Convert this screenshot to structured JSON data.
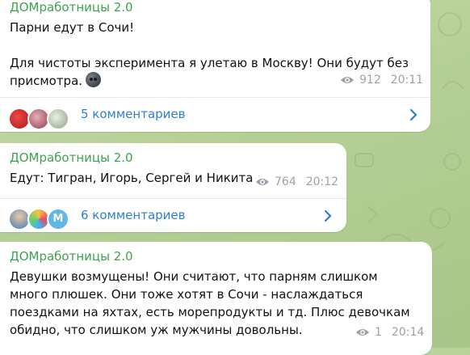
{
  "posts": [
    {
      "author": "ДОМработницы 2.0",
      "text": "Парни едут в Сочи!\n\nДля чистоты эксперимента я улетаю в Москву! Они будут без присмотра.",
      "emoji_icon": "neutral-face-dark-emoji",
      "views": "912",
      "time": "20:11",
      "comments_label": "5 комментариев"
    },
    {
      "author": "ДОМработницы 2.0",
      "text": "Едут: Тигран, Игорь, Сергей и Никита",
      "views": "764",
      "time": "20:12",
      "comments_label": "6 комментариев",
      "avatar_letter": "M"
    },
    {
      "author": "ДОМработницы 2.0",
      "text": "Девушки возмущены! Они считают, что парням слишком много плюшек. Они тоже хотят в Сочи - наслаждаться поездками на яхтах, есть морепродукты и тд. Плюс девочкам обидно, что слишком уж мужчины довольны.",
      "views": "1",
      "time": "20:14"
    }
  ],
  "colors": {
    "author": "#3fa34d",
    "link": "#2d7fd0",
    "meta": "#9aa3ab",
    "background": "#b4cf95"
  }
}
